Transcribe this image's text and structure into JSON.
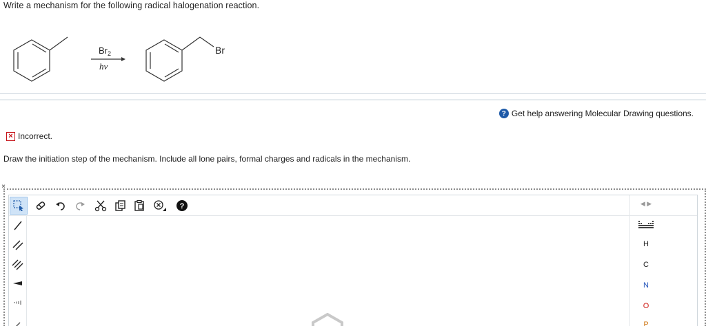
{
  "question": {
    "prompt": "Write a mechanism for the following radical halogenation reaction.",
    "reagent_top": "Br",
    "reagent_top_sub": "2",
    "reagent_bottom": "hν",
    "product_label": "Br"
  },
  "feedback": {
    "help_text": "Get help answering Molecular Drawing questions.",
    "status": "Incorrect.",
    "instruction": "Draw the initiation step of the mechanism. Include all lone pairs, formal charges and radicals in the mechanism."
  },
  "editor": {
    "elements": [
      "H",
      "C",
      "N",
      "O",
      "P"
    ],
    "element_colors": {
      "H": "#222222",
      "C": "#222222",
      "N": "#1d4fb8",
      "O": "#d0201a",
      "P": "#d07a1a"
    },
    "top_tools": [
      "select-tool",
      "eraser-tool",
      "undo-tool",
      "redo-tool",
      "cut-tool",
      "copy-tool",
      "paste-tool",
      "zoom-tool",
      "help-tool"
    ],
    "left_tools": [
      "single-bond",
      "double-bond",
      "triple-bond",
      "wedge-bond",
      "hash-bond"
    ]
  }
}
